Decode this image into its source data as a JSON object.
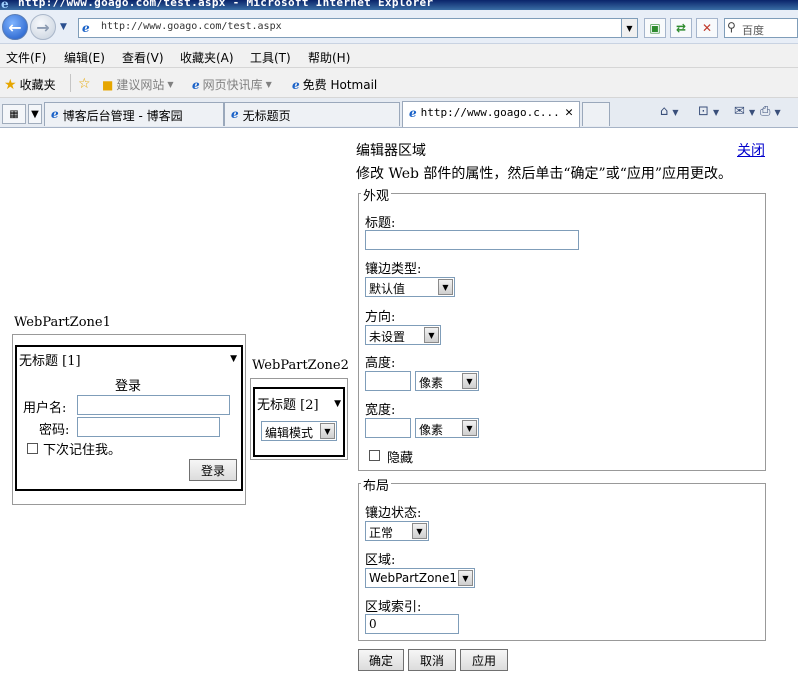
{
  "window": {
    "title": "http://www.goago.com/test.aspx - Microsoft Internet Explorer"
  },
  "address": {
    "url": "http://www.goago.com/test.aspx",
    "search_value": "百度"
  },
  "menu": [
    "文件(F)",
    "编辑(E)",
    "查看(V)",
    "收藏夹(A)",
    "工具(T)",
    "帮助(H)"
  ],
  "favorites": {
    "label": "收藏夹",
    "items": [
      "建议网站",
      "网页快讯库",
      "免费 Hotmail"
    ]
  },
  "tabs": [
    {
      "label": "博客后台管理 - 博客园"
    },
    {
      "label": "无标题页"
    },
    {
      "label": "http://www.goago.c..."
    }
  ],
  "zone1": {
    "title": "WebPartZone1",
    "part_title": "无标题",
    "part_index": "[1]",
    "login_title": "登录",
    "username_label": "用户名:",
    "password_label": "密码:",
    "remember_label": "下次记住我。",
    "login_button": "登录"
  },
  "zone2": {
    "title": "WebPartZone2",
    "part_title": "无标题",
    "part_index": "[2]",
    "mode_value": "编辑模式"
  },
  "editor": {
    "title": "编辑器区域",
    "close_link": "关闭",
    "description": "修改 Web 部件的属性，然后单击“确定”或“应用”应用更改。",
    "appearance": {
      "legend": "外观",
      "title_label": "标题:",
      "chrome_type_label": "镶边类型:",
      "chrome_type_value": "默认值",
      "direction_label": "方向:",
      "direction_value": "未设置",
      "height_label": "高度:",
      "height_unit": "像素",
      "width_label": "宽度:",
      "width_unit": "像素",
      "hidden_label": "隐藏"
    },
    "layout": {
      "legend": "布局",
      "chrome_state_label": "镶边状态:",
      "chrome_state_value": "正常",
      "zone_label": "区域:",
      "zone_value": "WebPartZone1",
      "zone_index_label": "区域索引:",
      "zone_index_value": "0"
    },
    "buttons": {
      "ok": "确定",
      "cancel": "取消",
      "apply": "应用"
    }
  }
}
